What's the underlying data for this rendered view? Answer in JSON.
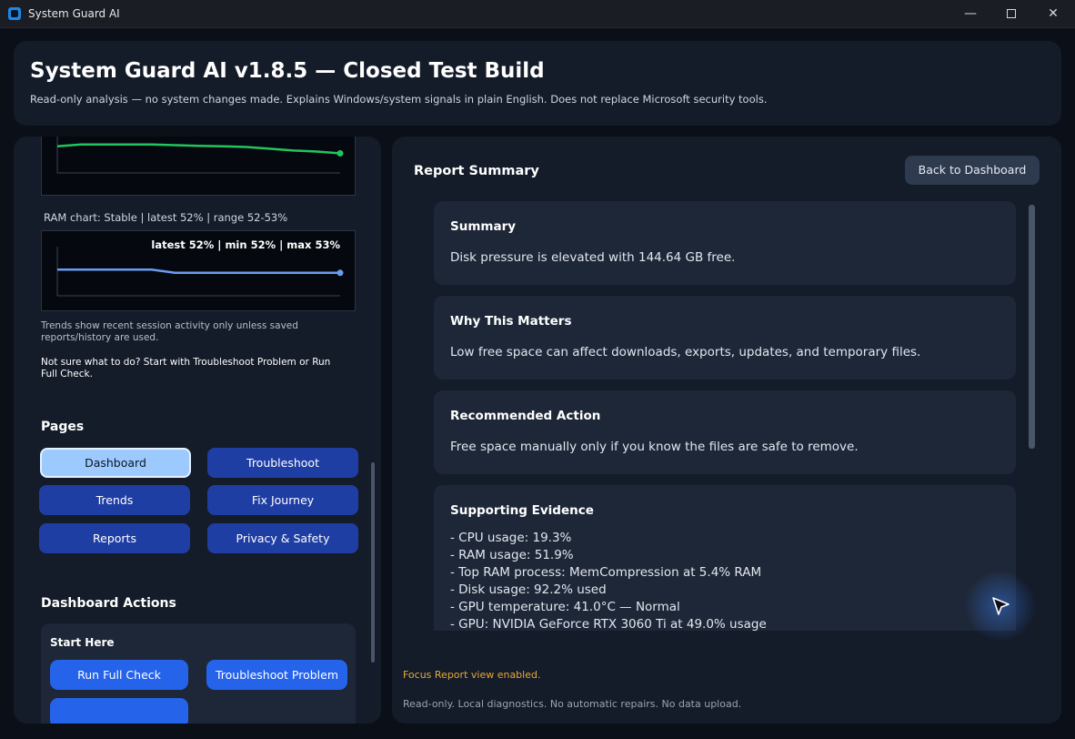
{
  "window": {
    "title": "System Guard AI",
    "icons": {
      "app": "app-logo-icon",
      "minimize": "minimize-icon",
      "maximize": "maximize-icon",
      "close": "close-icon"
    }
  },
  "header": {
    "title": "System Guard AI v1.8.5 — Closed Test Build",
    "subtitle": "Read-only analysis — no system changes made. Explains Windows/system signals in plain English. Does not replace Microsoft security tools."
  },
  "sidebar": {
    "cpu_chart": {
      "values": [
        52.5,
        53,
        53,
        53,
        53,
        52.8,
        52.6,
        52.5,
        52.3,
        51.8,
        51.3,
        51,
        50.5
      ],
      "ylim": [
        45,
        56
      ]
    },
    "ram_chart": {
      "caption": "RAM chart: Stable | latest 52% | range 52-53%",
      "stats": "latest 52% | min 52% | max 53%",
      "values": [
        53,
        53,
        53,
        53,
        53,
        52,
        52,
        52,
        52,
        52,
        52,
        52,
        52
      ],
      "ylim": [
        45,
        60
      ]
    },
    "trend_note": "Trends show recent session activity only unless saved reports/history are used.",
    "hint": "Not sure what to do? Start with Troubleshoot Problem or Run Full Check.",
    "pages_title": "Pages",
    "pages": [
      "Dashboard",
      "Troubleshoot",
      "Trends",
      "Fix Journey",
      "Reports",
      "Privacy & Safety"
    ],
    "active_page": "Dashboard",
    "actions_title": "Dashboard Actions",
    "start_card": {
      "title": "Start Here",
      "run_full_check": "Run Full Check",
      "troubleshoot_problem": "Troubleshoot Problem"
    }
  },
  "report": {
    "heading": "Report Summary",
    "back_button": "Back to Dashboard",
    "cards": [
      {
        "title": "Summary",
        "body": "Disk pressure is elevated with 144.64 GB free."
      },
      {
        "title": "Why This Matters",
        "body": "Low free space can affect downloads, exports, updates, and temporary files."
      },
      {
        "title": "Recommended Action",
        "body": "Free space manually only if you know the files are safe to remove."
      }
    ],
    "evidence": {
      "title": "Supporting Evidence",
      "items": [
        "- CPU usage: 19.3%",
        "- RAM usage: 51.9%",
        "- Top RAM process: MemCompression at 5.4% RAM",
        "- Disk usage: 92.2% used",
        "- GPU temperature: 41.0°C — Normal",
        "- GPU: NVIDIA GeForce RTX 3060 Ti at 49.0% usage"
      ]
    },
    "focus_status": "Focus Report view enabled.",
    "footer": "Read-only. Local diagnostics. No automatic repairs. No data upload."
  },
  "colors": {
    "cpu_line": "#22c55e",
    "ram_line": "#6b9cf0",
    "accent_button": "#2563eb",
    "page_button": "#1f3ea4",
    "active_page": "#9ccaff",
    "warning_text": "#e7a93a"
  },
  "cursor_icon": "mouse-pointer-icon"
}
